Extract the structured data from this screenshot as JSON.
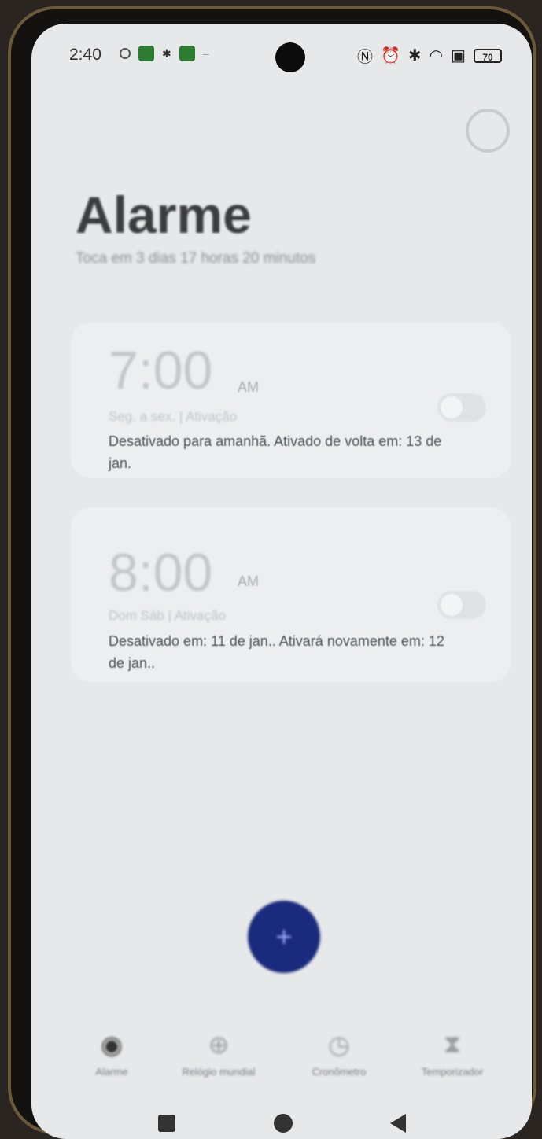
{
  "status_bar": {
    "time": "2:40",
    "battery": "70"
  },
  "header": {
    "title": "Alarme",
    "subtitle": "Toca em 3 dias 17 horas 20 minutos"
  },
  "alarms": [
    {
      "time": "7:00",
      "ampm": "AM",
      "days": "Seg. a sex. | Ativação",
      "status": "Desativado para amanhã. Ativado de volta em: 13 de jan.",
      "enabled": false
    },
    {
      "time": "8:00",
      "ampm": "AM",
      "days": "Dom Sáb | Ativação",
      "status": "Desativado em: 11 de jan.. Ativará novamente em: 12 de jan..",
      "enabled": false
    }
  ],
  "fab": {
    "label": "+"
  },
  "bottom_nav": [
    {
      "label": "Alarme",
      "icon": "alarm-icon"
    },
    {
      "label": "Relógio mundial",
      "icon": "globe-icon"
    },
    {
      "label": "Cronômetro",
      "icon": "stopwatch-icon"
    },
    {
      "label": "Temporizador",
      "icon": "hourglass-icon"
    }
  ],
  "colors": {
    "fab": "#1a2a7c",
    "screen_bg": "#e6e8ea"
  }
}
